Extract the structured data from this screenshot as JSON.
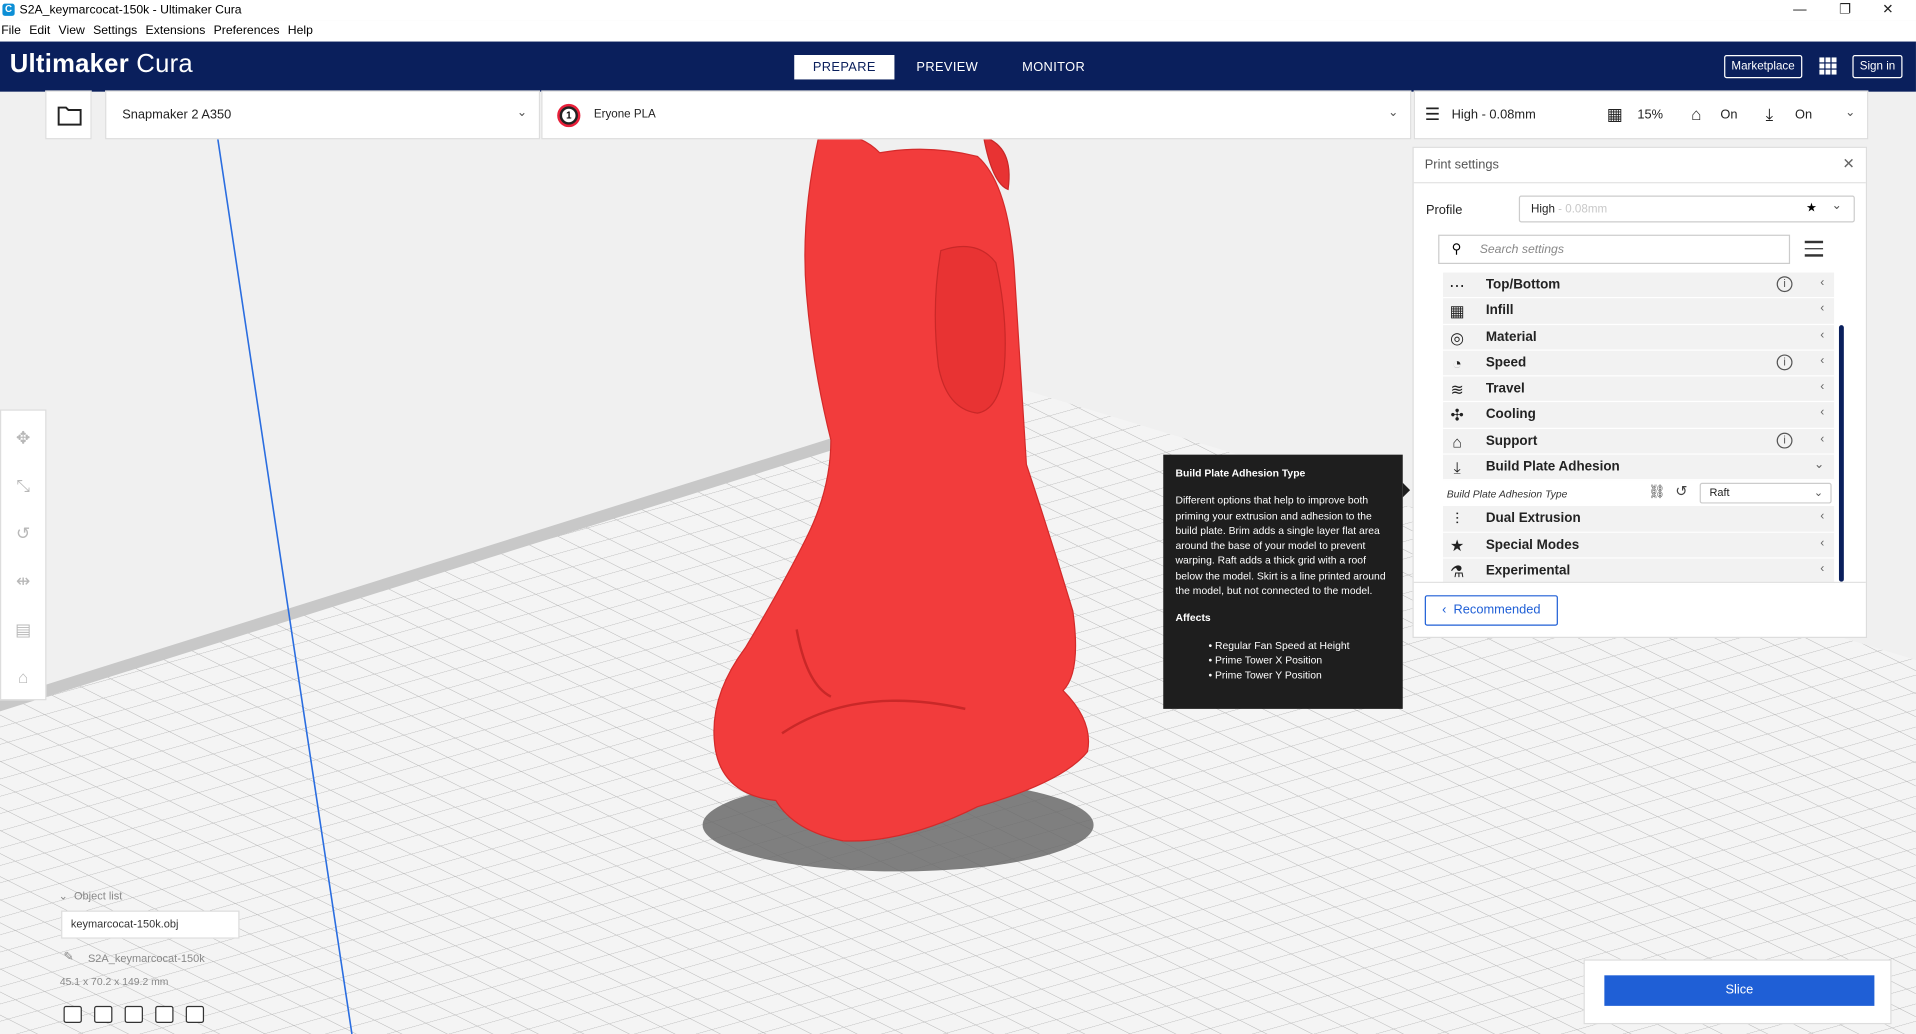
{
  "window": {
    "title": "S2A_keymarcocat-150k - Ultimaker Cura",
    "app_icon": "C",
    "controls": {
      "minimize": "—",
      "maximize": "❐",
      "close": "✕"
    }
  },
  "menu": [
    "File",
    "Edit",
    "View",
    "Settings",
    "Extensions",
    "Preferences",
    "Help"
  ],
  "header": {
    "logo_bold": "Ultimaker",
    "logo_light": " Cura",
    "tabs": [
      "PREPARE",
      "PREVIEW",
      "MONITOR"
    ],
    "active_tab": "PREPARE",
    "marketplace": "Marketplace",
    "sign_in": "Sign in",
    "colors": {
      "bar": "#0a1f5c",
      "accent": "#1f5fd6"
    }
  },
  "toolbar": {
    "machine": "Snapmaker 2 A350",
    "extruder_number": "1",
    "material": "Eryone PLA",
    "profile_summary": "High - 0.08mm",
    "infill": "15%",
    "support": "On",
    "adhesion": "On"
  },
  "print_settings": {
    "title": "Print settings",
    "profile_label": "Profile",
    "profile_name": "High",
    "profile_suffix": " - 0.08mm",
    "search_placeholder": "Search settings",
    "categories": [
      {
        "label": "Top/Bottom",
        "icon": "top-bottom-icon",
        "glyph": "⋯",
        "info": true
      },
      {
        "label": "Infill",
        "icon": "infill-icon",
        "glyph": "▦",
        "info": false
      },
      {
        "label": "Material",
        "icon": "material-icon",
        "glyph": "◎",
        "info": false
      },
      {
        "label": "Speed",
        "icon": "speed-icon",
        "glyph": "◔",
        "info": true
      },
      {
        "label": "Travel",
        "icon": "travel-icon",
        "glyph": "≋",
        "info": false
      },
      {
        "label": "Cooling",
        "icon": "cooling-icon",
        "glyph": "✣",
        "info": false
      },
      {
        "label": "Support",
        "icon": "support-icon",
        "glyph": "⌂",
        "info": true
      },
      {
        "label": "Build Plate Adhesion",
        "icon": "adhesion-icon",
        "glyph": "⤓",
        "info": false,
        "expanded": true
      },
      {
        "label": "Dual Extrusion",
        "icon": "dual-extrusion-icon",
        "glyph": "⫶",
        "info": false
      },
      {
        "label": "Special Modes",
        "icon": "special-modes-icon",
        "glyph": "★",
        "info": false
      },
      {
        "label": "Experimental",
        "icon": "experimental-icon",
        "glyph": "⚗",
        "info": false
      }
    ],
    "adhesion_setting": {
      "label": "Build Plate Adhesion Type",
      "value": "Raft"
    },
    "recommended_button": "Recommended"
  },
  "tooltip": {
    "title": "Build Plate Adhesion Type",
    "body": "Different options that help to improve both priming your extrusion and adhesion to the build plate. Brim adds a single layer flat area around the base of your model to prevent warping. Raft adds a thick grid with a roof below the model. Skirt is a line printed around the model, but not connected to the model.",
    "affects_label": "Affects",
    "affects": [
      "Regular Fan Speed at Height",
      "Prime Tower X Position",
      "Prime Tower Y Position"
    ]
  },
  "object_list": {
    "label": "Object list",
    "file": "keymarcocat-150k.obj",
    "name": "S2A_keymarcocat-150k",
    "dimensions": "45.1 x 70.2 x 149.2 mm"
  },
  "slice_button": "Slice",
  "model_color": "#f23c3c"
}
